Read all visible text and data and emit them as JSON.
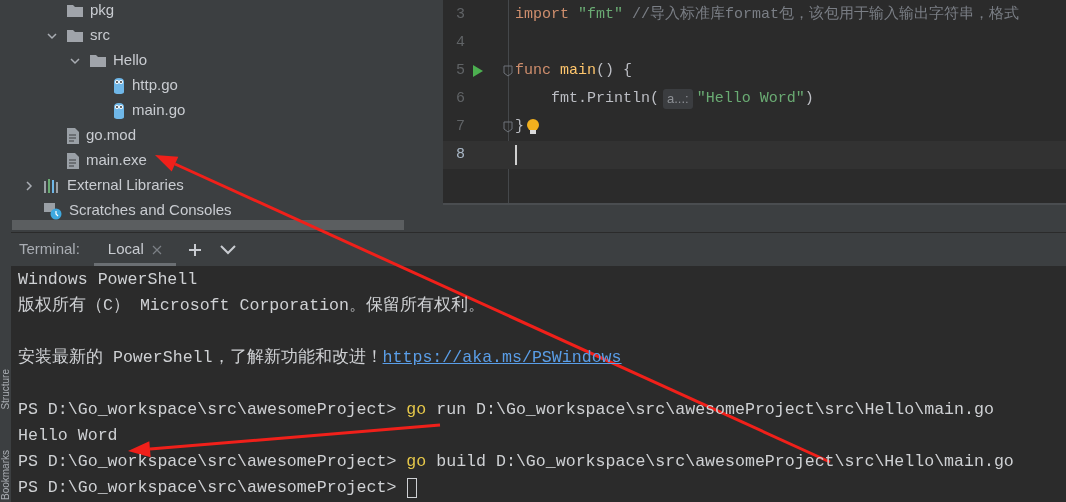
{
  "side_strip": {
    "labels": [
      "Structure",
      "Bookmarks"
    ]
  },
  "project_tree": {
    "files": [
      {
        "label": "pkg",
        "kind": "folder"
      },
      {
        "label": "src",
        "kind": "folder",
        "expanded": true,
        "children": [
          {
            "label": "Hello",
            "kind": "folder",
            "expanded": true,
            "children": [
              {
                "label": "http.go",
                "kind": "go"
              },
              {
                "label": "main.go",
                "kind": "go"
              }
            ]
          }
        ]
      },
      {
        "label": "go.mod",
        "kind": "file"
      },
      {
        "label": "main.exe",
        "kind": "file"
      }
    ],
    "roots": [
      {
        "label": "External Libraries",
        "kind": "libraries",
        "expanded": false
      },
      {
        "label": "Scratches and Consoles",
        "kind": "scratches"
      }
    ]
  },
  "editor": {
    "lines": [
      {
        "number": "3",
        "current": false,
        "run_button": false,
        "fold_marker": false,
        "intention_bulb": false,
        "tokens": [
          {
            "text": "import ",
            "kind": "keyword"
          },
          {
            "text": "\"fmt\"",
            "kind": "string"
          },
          {
            "text": " //导入标准库format包，该包用于输入输出字符串，格式",
            "kind": "comment"
          }
        ]
      },
      {
        "number": "4",
        "current": false,
        "run_button": false,
        "fold_marker": false,
        "intention_bulb": false
      },
      {
        "number": "5",
        "current": false,
        "run_button": true,
        "fold_marker": true,
        "intention_bulb": false,
        "tokens": [
          {
            "text": "func ",
            "kind": "keyword"
          },
          {
            "text": "main",
            "kind": "function"
          },
          {
            "text": "() {",
            "kind": "plain"
          }
        ]
      },
      {
        "number": "6",
        "current": false,
        "run_button": false,
        "fold_marker": false,
        "intention_bulb": false,
        "tokens": [
          {
            "text": "    fmt.Println(",
            "kind": "plain"
          },
          {
            "text": "a...:",
            "kind": "hint"
          },
          {
            "text": "\"Hello Word\"",
            "kind": "string"
          },
          {
            "text": ")",
            "kind": "plain"
          }
        ]
      },
      {
        "number": "7",
        "current": false,
        "run_button": false,
        "fold_marker": true,
        "intention_bulb": true,
        "tokens": [
          {
            "text": "}",
            "kind": "plain"
          }
        ]
      },
      {
        "number": "8",
        "current": true,
        "run_button": false,
        "fold_marker": false,
        "intention_bulb": false
      }
    ]
  },
  "terminal": {
    "title": "Terminal:",
    "tabs": [
      {
        "label": "Local",
        "selected": true,
        "closable": true
      }
    ],
    "lines": [
      {
        "kind": "output",
        "segments": [
          {
            "text": "Windows PowerShell",
            "kind": "plain"
          }
        ]
      },
      {
        "kind": "output",
        "segments": [
          {
            "text": "版权所有（C） Microsoft Corporation。保留所有权利。",
            "kind": "plain"
          }
        ]
      },
      {
        "kind": "blank"
      },
      {
        "kind": "output",
        "segments": [
          {
            "text": "安装最新的 PowerShell，了解新功能和改进！",
            "kind": "plain"
          },
          {
            "text": "https://aka.ms/PSWindows",
            "kind": "link"
          }
        ]
      },
      {
        "kind": "blank"
      },
      {
        "kind": "output",
        "segments": [
          {
            "text": "PS D:\\Go_workspace\\src\\awesomeProject> ",
            "kind": "plain"
          },
          {
            "text": "go",
            "kind": "command"
          },
          {
            "text": " run D:\\Go_workspace\\src\\awesomeProject\\src\\Hello\\main.go",
            "kind": "plain"
          }
        ]
      },
      {
        "kind": "output",
        "segments": [
          {
            "text": "Hello Word",
            "kind": "plain"
          }
        ]
      },
      {
        "kind": "output",
        "segments": [
          {
            "text": "PS D:\\Go_workspace\\src\\awesomeProject> ",
            "kind": "plain"
          },
          {
            "text": "go",
            "kind": "command"
          },
          {
            "text": " build D:\\Go_workspace\\src\\awesomeProject\\src\\Hello\\main.go",
            "kind": "plain"
          }
        ]
      },
      {
        "kind": "output",
        "segments": [
          {
            "text": "PS D:\\Go_workspace\\src\\awesomeProject> ",
            "kind": "plain"
          },
          {
            "kind": "cursor"
          }
        ]
      }
    ]
  }
}
